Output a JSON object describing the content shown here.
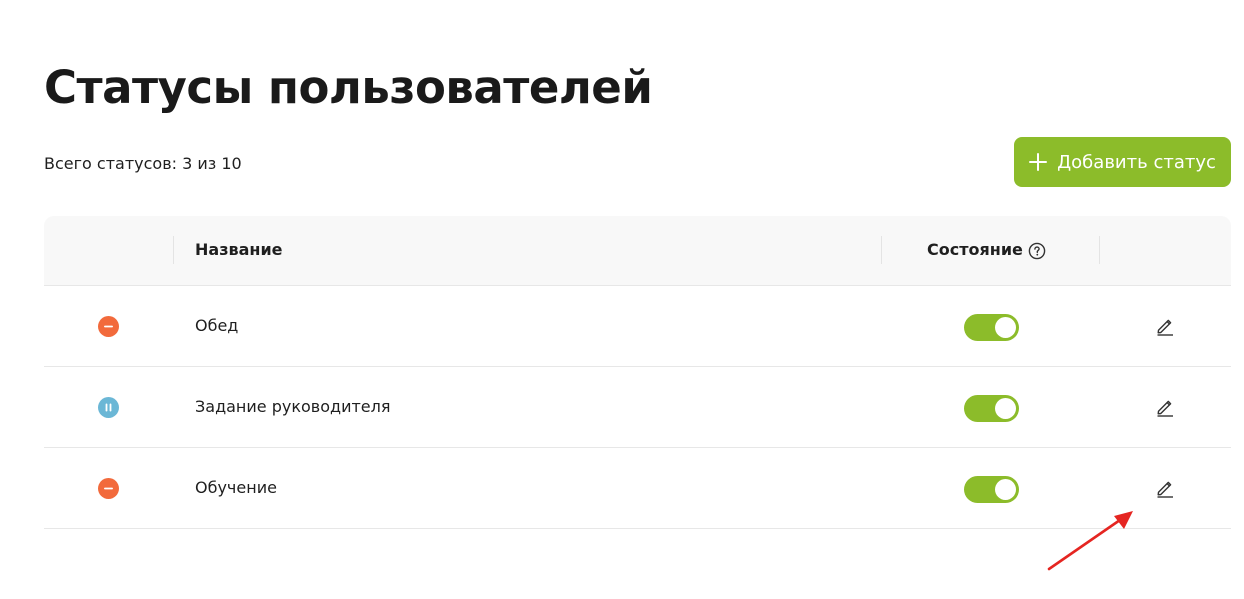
{
  "page": {
    "title": "Статусы пользователей",
    "status_count": "Всего статусов: 3 из 10",
    "add_button_label": "Добавить статус"
  },
  "table": {
    "columns": {
      "name": "Название",
      "state": "Состояние"
    },
    "rows": [
      {
        "icon": "minus-circle-icon",
        "icon_color": "#f26a3c",
        "name": "Обед",
        "enabled": true
      },
      {
        "icon": "pause-circle-icon",
        "icon_color": "#6bb7d6",
        "name": "Задание руководителя",
        "enabled": true
      },
      {
        "icon": "minus-circle-icon",
        "icon_color": "#f26a3c",
        "name": "Обучение",
        "enabled": true
      }
    ]
  },
  "colors": {
    "accent_green": "#8cbc2a",
    "annotation_arrow": "#e52521"
  }
}
